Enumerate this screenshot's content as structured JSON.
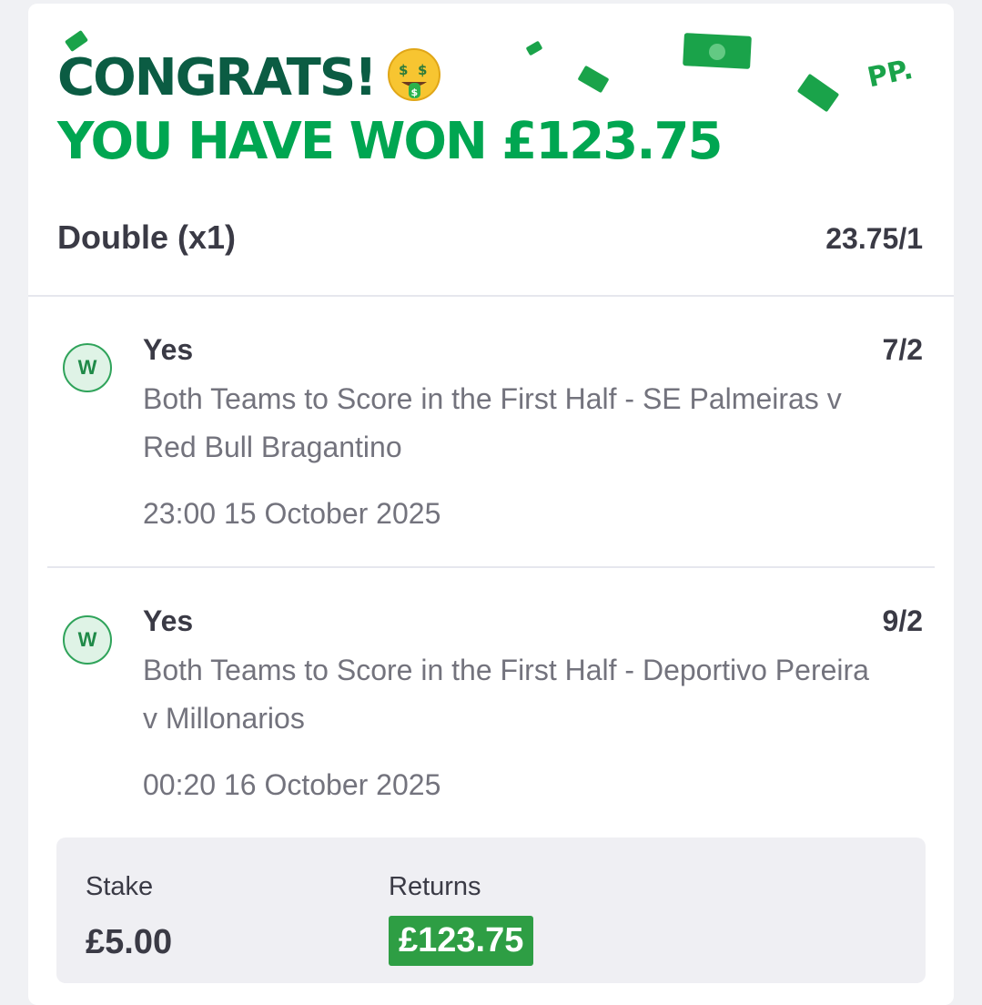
{
  "header": {
    "congrats_text": "CONGRATS!",
    "won_text": "YOU HAVE WON £123.75",
    "emoji_icon": "money-mouth-face-icon",
    "pp_logo": "PP."
  },
  "bet": {
    "type": "Double (x1)",
    "odds": "23.75/1"
  },
  "legs": [
    {
      "status": "W",
      "selection": "Yes",
      "odds": "7/2",
      "market": "Both Teams to Score in the First Half - SE Palmeiras v Red Bull Bragantino",
      "time": "23:00 15 October 2025"
    },
    {
      "status": "W",
      "selection": "Yes",
      "odds": "9/2",
      "market": "Both Teams to Score in the First Half - Deportivo Pereira v Millonarios",
      "time": "00:20 16 October 2025"
    }
  ],
  "summary": {
    "stake_label": "Stake",
    "stake_value": "£5.00",
    "returns_label": "Returns",
    "returns_value": "£123.75"
  },
  "colors": {
    "brand_dark_green": "#0b5c43",
    "brand_green": "#00a651",
    "returns_green": "#2e9e44",
    "win_badge_border": "#2fa35a"
  }
}
